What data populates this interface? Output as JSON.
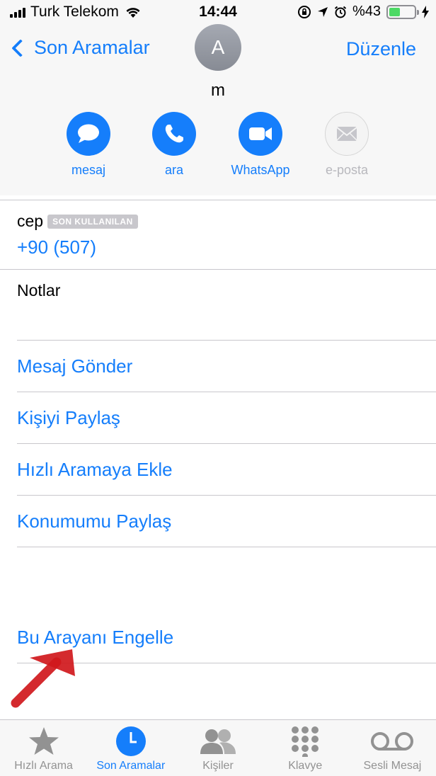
{
  "status_bar": {
    "carrier": "Turk Telekom",
    "time": "14:44",
    "battery_text": "%43",
    "battery_level": 0.43
  },
  "nav": {
    "back_label": "Son Aramalar",
    "edit_label": "Düzenle"
  },
  "contact": {
    "avatar_initial": "A",
    "name": "m"
  },
  "actions": [
    {
      "label": "mesaj",
      "icon": "message-icon"
    },
    {
      "label": "ara",
      "icon": "phone-icon"
    },
    {
      "label": "WhatsApp",
      "icon": "video-icon"
    },
    {
      "label": "e-posta",
      "icon": "mail-icon",
      "disabled": true
    }
  ],
  "phone": {
    "label": "cep",
    "badge": "SON KULLANILAN",
    "number": "+90 (507)"
  },
  "notes": {
    "label": "Notlar"
  },
  "menu": {
    "send_message": "Mesaj Gönder",
    "share_contact": "Kişiyi Paylaş",
    "add_favorite": "Hızlı Aramaya Ekle",
    "share_location": "Konumumu Paylaş"
  },
  "block": {
    "label": "Bu Arayanı Engelle"
  },
  "tabs": [
    {
      "label": "Hızlı Arama",
      "icon": "star-icon"
    },
    {
      "label": "Son Aramalar",
      "icon": "clock-icon",
      "active": true
    },
    {
      "label": "Kişiler",
      "icon": "contacts-icon"
    },
    {
      "label": "Klavye",
      "icon": "keypad-icon"
    },
    {
      "label": "Sesli Mesaj",
      "icon": "voicemail-icon"
    }
  ],
  "colors": {
    "accent": "#157efb",
    "annotation_arrow": "#d0181c",
    "battery": "#4cd964"
  }
}
